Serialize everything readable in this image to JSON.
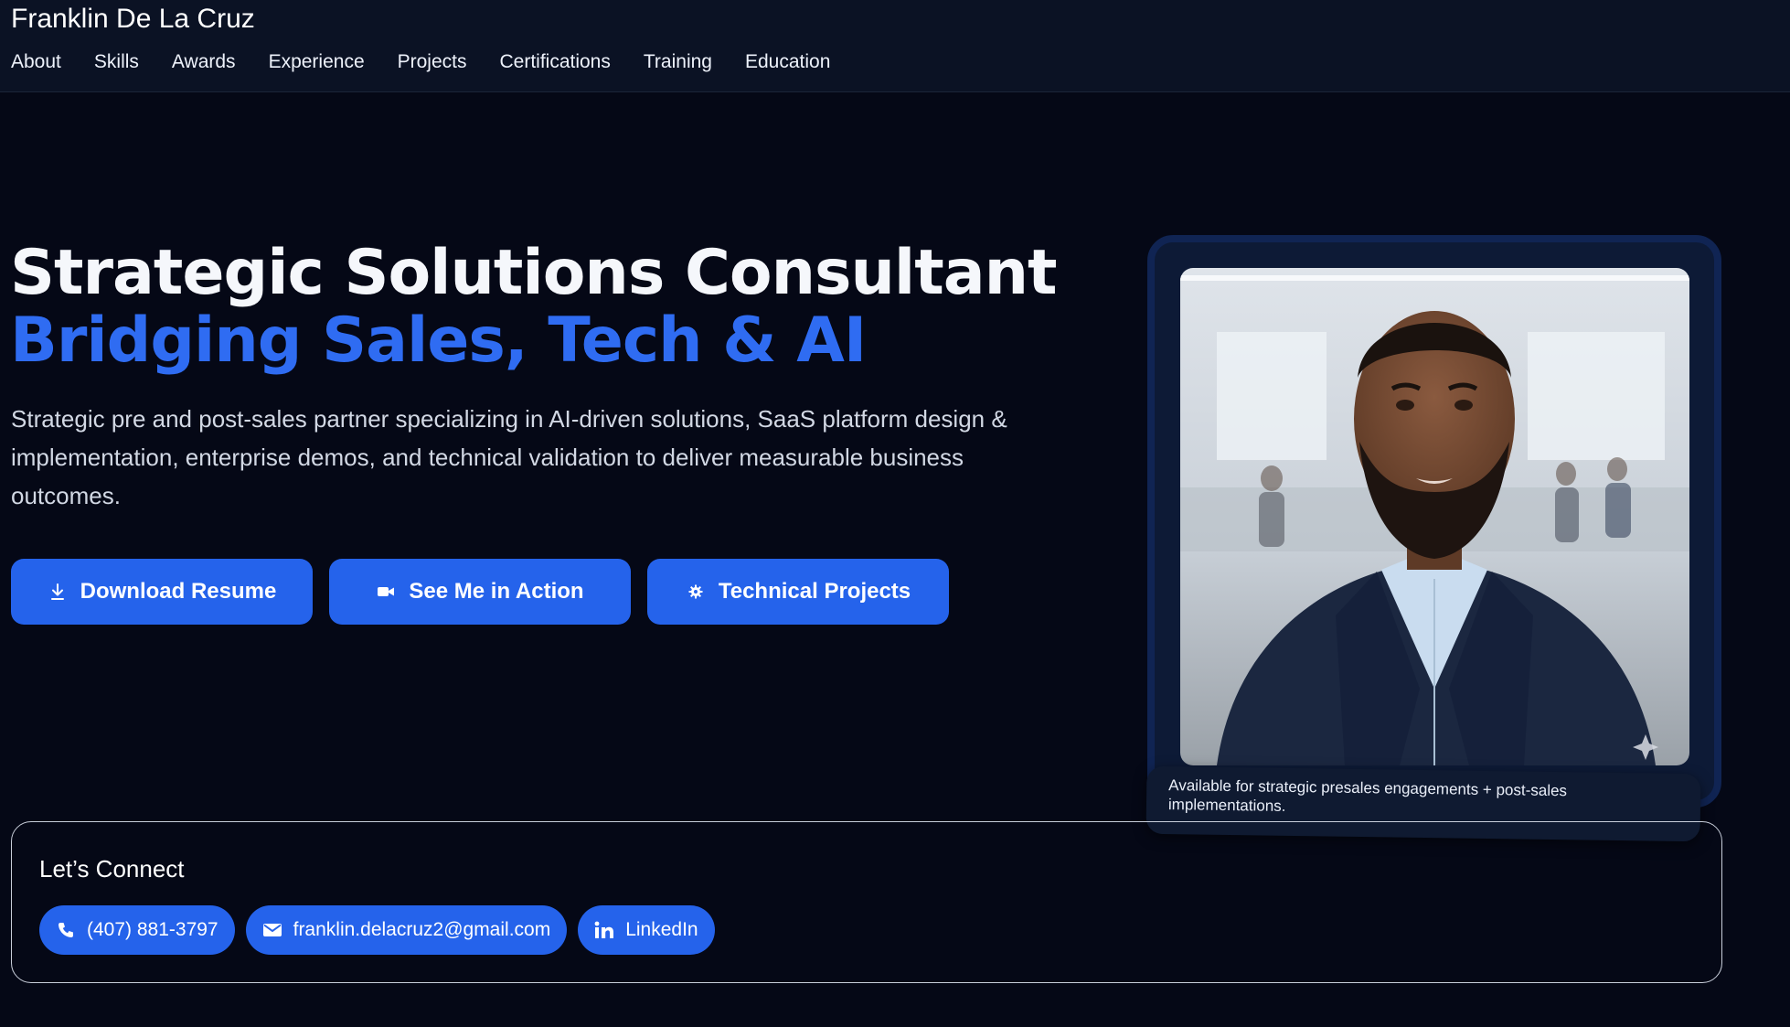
{
  "header": {
    "brand": "Franklin De La Cruz",
    "nav": [
      "About",
      "Skills",
      "Awards",
      "Experience",
      "Projects",
      "Certifications",
      "Training",
      "Education"
    ]
  },
  "hero": {
    "title": "Strategic Solutions Consultant",
    "subtitle": "Bridging Sales, Tech & AI",
    "description": "Strategic pre and post-sales partner specializing in AI-driven solutions, SaaS platform design & implementation, enterprise demos, and technical validation to deliver measurable business outcomes.",
    "buttons": [
      {
        "label": "Download Resume",
        "icon": "download-icon"
      },
      {
        "label": "See Me in Action",
        "icon": "video-camera-icon"
      },
      {
        "label": "Technical Projects",
        "icon": "gear-icon"
      }
    ]
  },
  "profile": {
    "caption": "Available for strategic presales engagements + post-sales implementations."
  },
  "connect": {
    "title": "Let’s Connect",
    "phone": "(407) 881-3797",
    "email": "franklin.delacruz2@gmail.com",
    "linkedin": "LinkedIn"
  },
  "colors": {
    "background": "#050816",
    "header": "#0b1224",
    "accent": "#2563eb",
    "accent_text": "#2f6cf2"
  }
}
